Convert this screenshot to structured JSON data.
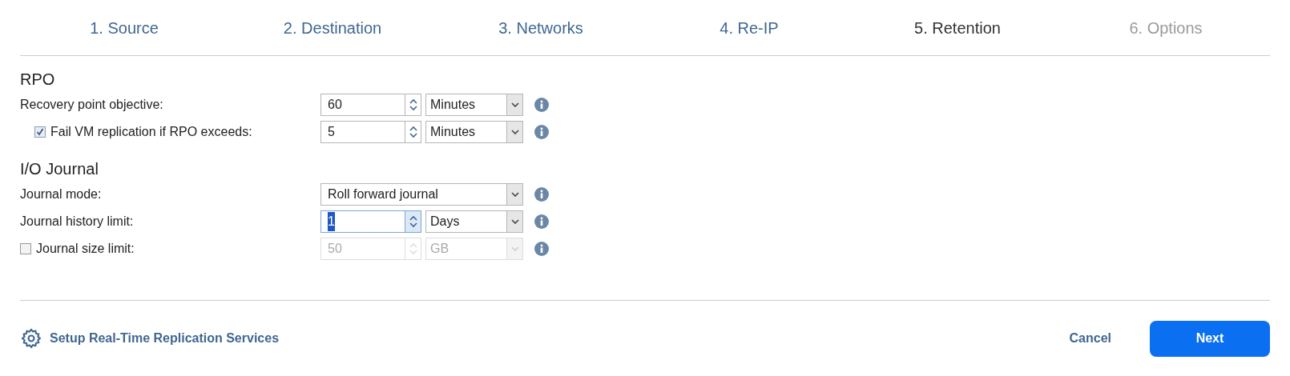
{
  "steps": [
    {
      "label": "1. Source",
      "selected": false,
      "disabled": false
    },
    {
      "label": "2. Destination",
      "selected": false,
      "disabled": false
    },
    {
      "label": "3. Networks",
      "selected": false,
      "disabled": false
    },
    {
      "label": "4. Re-IP",
      "selected": false,
      "disabled": false
    },
    {
      "label": "5. Retention",
      "selected": true,
      "disabled": false
    },
    {
      "label": "6. Options",
      "selected": false,
      "disabled": true
    }
  ],
  "sections": [
    {
      "title": "RPO",
      "rows": [
        {
          "kind": "spinner",
          "label": "Recovery point objective:",
          "value": "60",
          "unit": "Minutes",
          "disabled": false,
          "focused": false
        },
        {
          "kind": "spinner",
          "label": "Fail VM replication if RPO exceeds:",
          "checkbox": {
            "checked": true
          },
          "value": "5",
          "unit": "Minutes",
          "disabled": false,
          "focused": false
        }
      ]
    },
    {
      "title": "I/O Journal",
      "rows": [
        {
          "kind": "select",
          "label": "Journal mode:",
          "value": "Roll forward journal",
          "disabled": false
        },
        {
          "kind": "spinner",
          "label": "Journal history limit:",
          "value": "1",
          "unit": "Days",
          "disabled": false,
          "focused": true
        },
        {
          "kind": "spinner",
          "label": "Journal size limit:",
          "checkbox": {
            "checked": false
          },
          "value": "50",
          "unit": "GB",
          "disabled": true,
          "focused": false
        }
      ]
    }
  ],
  "footer": {
    "setup_link": "Setup Real-Time Replication Services",
    "buttons": [
      {
        "label": "Cancel",
        "kind": "secondary"
      },
      {
        "label": "Next",
        "kind": "primary"
      }
    ]
  }
}
